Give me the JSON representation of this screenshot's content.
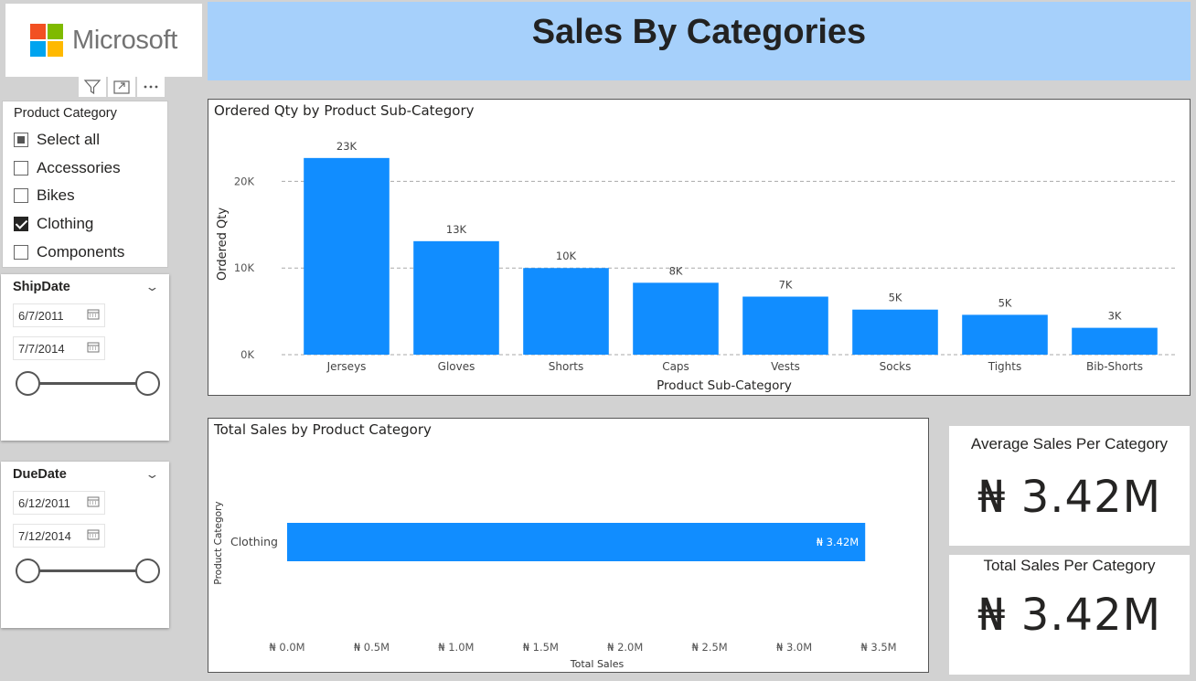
{
  "logo": {
    "text": "Microsoft",
    "colors": [
      "#f25022",
      "#7fba00",
      "#00a4ef",
      "#ffb900"
    ]
  },
  "title": "Sales By Categories",
  "visual_header": {
    "filter_icon": "filter-icon",
    "focus_icon": "focus-mode-icon",
    "more_icon": "more-options-icon"
  },
  "product_slicer": {
    "header": "Product Category",
    "items": [
      {
        "label": "Select all",
        "state": "partial"
      },
      {
        "label": "Accessories",
        "state": "unchecked"
      },
      {
        "label": "Bikes",
        "state": "unchecked"
      },
      {
        "label": "Clothing",
        "state": "checked"
      },
      {
        "label": "Components",
        "state": "unchecked"
      }
    ]
  },
  "ship_slicer": {
    "header": "ShipDate",
    "start": "6/7/2011",
    "end": "7/7/2014"
  },
  "due_slicer": {
    "header": "DueDate",
    "start": "6/12/2011",
    "end": "7/12/2014"
  },
  "colors": {
    "bar": "#118dff",
    "banner": "#a6d0fb"
  },
  "column_chart": {
    "title": "Ordered Qty by Product Sub-Category",
    "xlabel": "Product Sub-Category",
    "ylabel": "Ordered Qty",
    "yticks": [
      "0K",
      "10K",
      "20K"
    ]
  },
  "bar_chart": {
    "title": "Total Sales by Product Category",
    "xlabel": "Total Sales",
    "ylabel": "Product Category",
    "xticks": [
      "₦ 0.0M",
      "₦ 0.5M",
      "₦ 1.0M",
      "₦ 1.5M",
      "₦ 2.0M",
      "₦ 2.5M",
      "₦ 3.0M",
      "₦ 3.5M"
    ]
  },
  "kpi_avg": {
    "label": "Average Sales Per Category",
    "value": "₦ 3.42M"
  },
  "kpi_total": {
    "label": "Total Sales Per Category",
    "value": "₦ 3.42M"
  },
  "chart_data": [
    {
      "type": "bar",
      "title": "Ordered Qty by Product Sub-Category",
      "xlabel": "Product Sub-Category",
      "ylabel": "Ordered Qty",
      "categories": [
        "Jerseys",
        "Gloves",
        "Shorts",
        "Caps",
        "Vests",
        "Socks",
        "Tights",
        "Bib-Shorts"
      ],
      "values": [
        22700,
        13100,
        10000,
        8300,
        6700,
        5200,
        4600,
        3100
      ],
      "data_labels": [
        "23K",
        "13K",
        "10K",
        "8K",
        "7K",
        "5K",
        "5K",
        "3K"
      ],
      "ylim": [
        0,
        23000
      ],
      "grid": true
    },
    {
      "type": "bar",
      "orientation": "horizontal",
      "title": "Total Sales by Product Category",
      "xlabel": "Total Sales",
      "ylabel": "Product Category",
      "categories": [
        "Clothing"
      ],
      "values": [
        3420000
      ],
      "data_labels": [
        "₦ 3.42M"
      ],
      "xlim": [
        0,
        3500000
      ],
      "grid": false
    }
  ]
}
